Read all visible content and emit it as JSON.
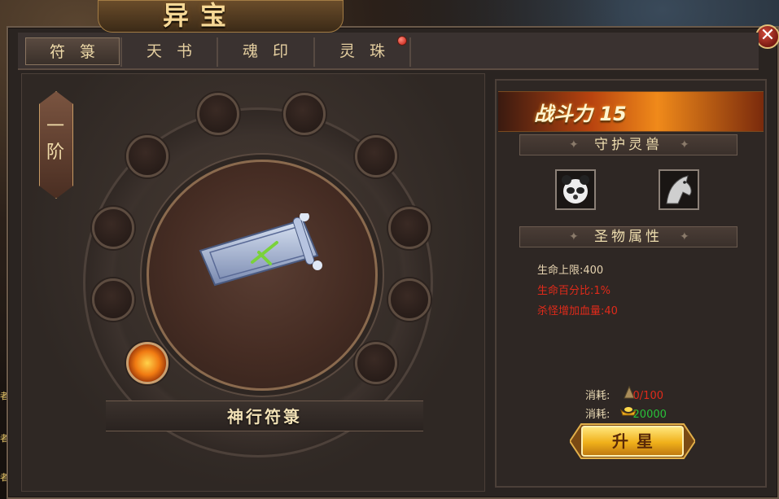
{
  "window": {
    "title": "异宝",
    "close_label": "✕"
  },
  "tabs": [
    {
      "label": "符箓",
      "active": true
    },
    {
      "label": "天书",
      "active": false
    },
    {
      "label": "魂印",
      "active": false
    },
    {
      "label": "灵珠",
      "active": false,
      "has_notification": true
    }
  ],
  "left_snippets": [
    "者",
    "者",
    "者"
  ],
  "artifact": {
    "rank": "一阶",
    "name": "神行符箓",
    "slots_total": 10,
    "slots_filled": 1
  },
  "right_panel": {
    "power_label": "战斗力",
    "power_value": "15",
    "guardian_section": "守护灵兽",
    "beasts": [
      {
        "icon": "panda-beast-icon"
      },
      {
        "icon": "horse-beast-icon"
      }
    ],
    "attr_section": "圣物属性",
    "attributes": [
      {
        "text": "生命上限:400",
        "color": "#e6d3b0"
      },
      {
        "text": "生命百分比:1%",
        "color": "#e02a1a"
      },
      {
        "text": "杀怪增加血量:40",
        "color": "#e02a1a"
      }
    ],
    "costs": [
      {
        "label": "消耗:",
        "icon": "material-icon",
        "value": "0/100",
        "color": "#e02a1a"
      },
      {
        "label": "消耗:",
        "icon": "gold-ingot-icon",
        "value": "20000",
        "color": "#28c23a"
      }
    ],
    "upgrade_label": "升星"
  }
}
